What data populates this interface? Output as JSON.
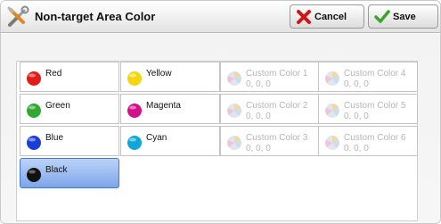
{
  "header": {
    "title": "Non-target Area Color",
    "title_icon": "tools-icon",
    "cancel_label": "Cancel",
    "save_label": "Save"
  },
  "colors": {
    "red": {
      "label": "Red",
      "hex": "#e21b1b"
    },
    "green": {
      "label": "Green",
      "hex": "#32a832"
    },
    "blue": {
      "label": "Blue",
      "hex": "#1b3fd6"
    },
    "black": {
      "label": "Black",
      "hex": "#111111"
    },
    "yellow": {
      "label": "Yellow",
      "hex": "#f5d50c"
    },
    "magenta": {
      "label": "Magenta",
      "hex": "#d40f8c"
    },
    "cyan": {
      "label": "Cyan",
      "hex": "#0fa7d8"
    }
  },
  "custom_colors": [
    {
      "label": "Custom Color 1",
      "value": "0, 0, 0"
    },
    {
      "label": "Custom Color 2",
      "value": "0, 0, 0"
    },
    {
      "label": "Custom Color 3",
      "value": "0, 0, 0"
    },
    {
      "label": "Custom Color 4",
      "value": "0, 0, 0"
    },
    {
      "label": "Custom Color 5",
      "value": "0, 0, 0"
    },
    {
      "label": "Custom Color 6",
      "value": "0, 0, 0"
    }
  ],
  "selected": "Black",
  "accent": {
    "selected_bg": "#8fb2ee",
    "cancel_x": "#d01616",
    "save_check": "#3aa62d"
  }
}
